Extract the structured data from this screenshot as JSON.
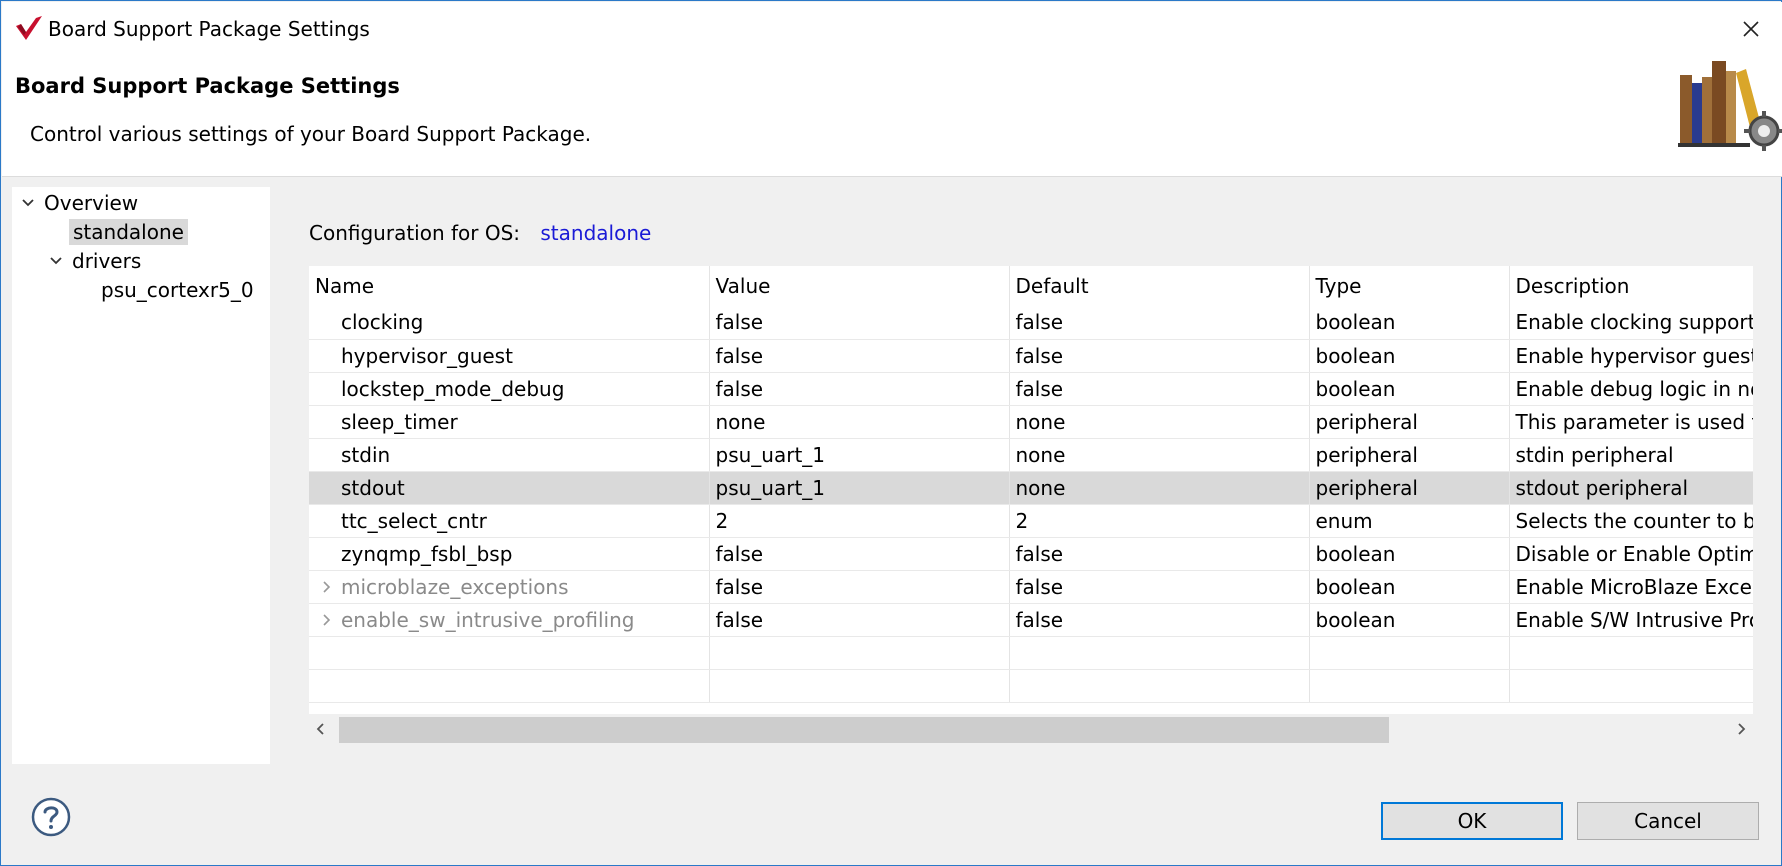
{
  "window": {
    "title": "Board Support Package Settings"
  },
  "header": {
    "title": "Board Support Package Settings",
    "description": "Control various settings of your Board Support Package."
  },
  "tree": {
    "overview": "Overview",
    "standalone": "standalone",
    "drivers": "drivers",
    "psu": "psu_cortexr5_0"
  },
  "config": {
    "label": "Configuration for OS:",
    "os": "standalone"
  },
  "table": {
    "columns": [
      "Name",
      "Value",
      "Default",
      "Type",
      "Description"
    ],
    "rows": [
      {
        "name": "clocking",
        "value": "false",
        "default": "false",
        "type": "boolean",
        "description": "Enable clocking support"
      },
      {
        "name": "hypervisor_guest",
        "value": "false",
        "default": "false",
        "type": "boolean",
        "description": "Enable hypervisor guest su"
      },
      {
        "name": "lockstep_mode_debug",
        "value": "false",
        "default": "false",
        "type": "boolean",
        "description": "Enable debug logic in non"
      },
      {
        "name": "sleep_timer",
        "value": "none",
        "default": "none",
        "type": "peripheral",
        "description": "This parameter is used to"
      },
      {
        "name": "stdin",
        "value": "psu_uart_1",
        "default": "none",
        "type": "peripheral",
        "description": "stdin peripheral"
      },
      {
        "name": "stdout",
        "value": "psu_uart_1",
        "default": "none",
        "type": "peripheral",
        "description": "stdout peripheral"
      },
      {
        "name": "ttc_select_cntr",
        "value": "2",
        "default": "2",
        "type": "enum",
        "description": "Selects the counter to be"
      },
      {
        "name": "zynqmp_fsbl_bsp",
        "value": "false",
        "default": "false",
        "type": "boolean",
        "description": "Disable or Enable Optimiz"
      },
      {
        "name": "microblaze_exceptions",
        "value": "false",
        "default": "false",
        "type": "boolean",
        "description": "Enable MicroBlaze Except"
      },
      {
        "name": "enable_sw_intrusive_profiling",
        "value": "false",
        "default": "false",
        "type": "boolean",
        "description": "Enable S/W Intrusive Prof"
      }
    ]
  },
  "buttons": {
    "ok": "OK",
    "cancel": "Cancel"
  },
  "colors": {
    "accent": "#0078d7",
    "link": "#1a1ad6",
    "selection": "#d9d9d9"
  },
  "icons": {
    "app": "xilinx-logo-icon",
    "close": "close-icon",
    "header_art": "books-gear-icon",
    "help": "help-icon"
  }
}
